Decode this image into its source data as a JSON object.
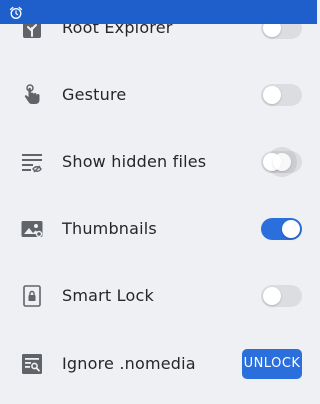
{
  "status_bar": {
    "icon": "alarm-icon",
    "color": "#1f5fcb"
  },
  "settings": [
    {
      "label": "Root Explorer",
      "icon": "root-explorer-icon",
      "control": "toggle",
      "state": "off"
    },
    {
      "label": "Gesture",
      "icon": "gesture-hand-icon",
      "control": "toggle",
      "state": "off"
    },
    {
      "label": "Show hidden files",
      "icon": "hidden-files-icon",
      "control": "toggle",
      "state": "off-pressed"
    },
    {
      "label": "Thumbnails",
      "icon": "thumbnails-icon",
      "control": "toggle",
      "state": "on"
    },
    {
      "label": "Smart Lock",
      "icon": "lock-icon",
      "control": "toggle",
      "state": "off"
    },
    {
      "label": "Ignore .nomedia",
      "icon": "nomedia-search-icon",
      "control": "button",
      "button_label": "UNLOCK"
    }
  ],
  "colors": {
    "accent": "#2b6fdc",
    "toggle_off": "#dcdde0",
    "background": "#eef0f3"
  }
}
